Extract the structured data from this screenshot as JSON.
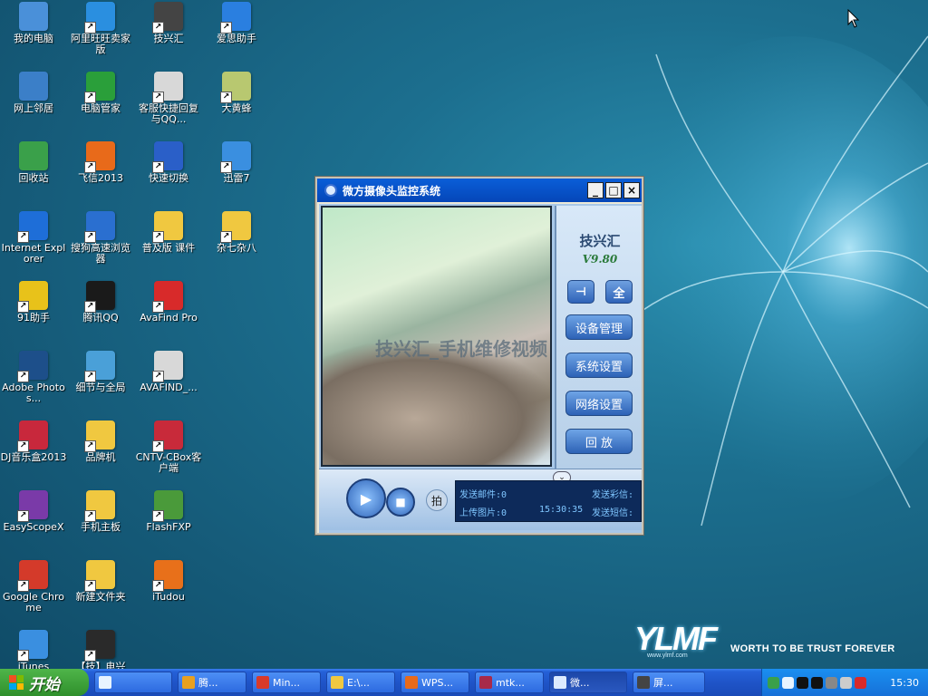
{
  "desktop": {
    "icons": [
      {
        "label": "我的电脑",
        "icon": "my-computer-icon",
        "color": "#4a90d9"
      },
      {
        "label": "网上邻居",
        "icon": "network-places-icon",
        "color": "#3b7fc8"
      },
      {
        "label": "回收站",
        "icon": "recycle-bin-icon",
        "color": "#3aa04a"
      },
      {
        "label": "Internet Explorer",
        "icon": "internet-explorer-icon",
        "color": "#1e6ed8"
      },
      {
        "label": "91助手",
        "icon": "assistant-91-icon",
        "color": "#e8c21a"
      },
      {
        "label": "Adobe Photos...",
        "icon": "photoshop-icon",
        "color": "#1d4f8a"
      },
      {
        "label": "DJ音乐盒2013",
        "icon": "dj-music-box-icon",
        "color": "#c8283c"
      },
      {
        "label": "EasyScopeX",
        "icon": "easyscopex-icon",
        "color": "#7a3aa8"
      },
      {
        "label": "Google Chrome",
        "icon": "chrome-icon",
        "color": "#d43a2a"
      },
      {
        "label": "iTunes",
        "icon": "itunes-icon",
        "color": "#3a8fe0"
      },
      {
        "label": "阿里旺旺卖家版",
        "icon": "aliwangwang-icon",
        "color": "#2a8fe0"
      },
      {
        "label": "电脑管家",
        "icon": "pc-manager-icon",
        "color": "#2a9f3a"
      },
      {
        "label": "飞信2013",
        "icon": "fetion-icon",
        "color": "#e86a1a"
      },
      {
        "label": "搜狗高速浏览器",
        "icon": "sogou-browser-icon",
        "color": "#2a6fd0"
      },
      {
        "label": "腾讯QQ",
        "icon": "qq-icon",
        "color": "#1a1a1a"
      },
      {
        "label": "细节与全局",
        "icon": "detail-global-icon",
        "color": "#4aa0d8"
      },
      {
        "label": "品牌机",
        "icon": "folder-icon",
        "color": "#f0c840"
      },
      {
        "label": "手机主板",
        "icon": "folder-icon",
        "color": "#f0c840"
      },
      {
        "label": "新建文件夹",
        "icon": "folder-icon",
        "color": "#f0c840"
      },
      {
        "label": "【技】电兴",
        "icon": "fct-icon",
        "color": "#2a2a2a"
      },
      {
        "label": "技兴汇",
        "icon": "jixinghui-icon",
        "color": "#444444"
      },
      {
        "label": "客服快捷回复与QQ...",
        "icon": "document-icon",
        "color": "#d8d8d8"
      },
      {
        "label": "快速切换",
        "icon": "quick-switch-icon",
        "color": "#2a5fc8"
      },
      {
        "label": "普及版 课件",
        "icon": "folder-icon",
        "color": "#f0c840"
      },
      {
        "label": "AvaFind Pro",
        "icon": "avafind-icon",
        "color": "#d82a2a"
      },
      {
        "label": "AVAFIND_...",
        "icon": "document-icon",
        "color": "#d8d8d8"
      },
      {
        "label": "CNTV-CBox客户端",
        "icon": "cntv-cbox-icon",
        "color": "#c82a3a"
      },
      {
        "label": "FlashFXP",
        "icon": "flashfxp-icon",
        "color": "#4a9a3a"
      },
      {
        "label": "iTudou",
        "icon": "itudou-icon",
        "color": "#e8701a"
      },
      {
        "label": "爱思助手",
        "icon": "aisi-assistant-icon",
        "color": "#2a7fe0"
      },
      {
        "label": "大黄蜂",
        "icon": "bumblebee-icon",
        "color": "#b8c870"
      },
      {
        "label": "迅雷7",
        "icon": "thunder-icon",
        "color": "#3a8fe0"
      },
      {
        "label": "杂七杂八",
        "icon": "folder-icon",
        "color": "#f0c840"
      }
    ]
  },
  "wallpaper": {
    "logo": "YLMF",
    "url": "www.ylmf.com",
    "tagline": "WORTH TO BE TRUST FOREVER"
  },
  "window": {
    "title": "微方摄像头监控系统",
    "minimize": "_",
    "maximize": "□",
    "close": "×",
    "video_overlay": "技兴汇_手机维修视频",
    "brand": "技兴汇",
    "version": "V9.80",
    "pin_button": "⊣",
    "full_button": "全",
    "buttons": [
      "设备管理",
      "系统设置",
      "网络设置",
      "回 放"
    ],
    "play_label": "▶",
    "stop_label": "■",
    "shoot_label": "拍",
    "collapse_label": "⌄",
    "status": {
      "send_mail": "发送邮件:0",
      "send_video": "发送彩信:",
      "upload_image": "上传图片:0",
      "time": "15:30:35",
      "send_sms": "发送短信:"
    }
  },
  "taskbar": {
    "start_label": "开始",
    "tasks": [
      {
        "label": "",
        "icon": "ie-task-icon",
        "color": "#e8f4ff"
      },
      {
        "label": "腾...",
        "icon": "chrome-task-icon",
        "color": "#e8a020"
      },
      {
        "label": "Min...",
        "icon": "gmail-task-icon",
        "color": "#d83a2a"
      },
      {
        "label": "E:\\...",
        "icon": "explorer-task-icon",
        "color": "#f0c840"
      },
      {
        "label": "WPS...",
        "icon": "wps-task-icon",
        "color": "#e86a1a"
      },
      {
        "label": "mtk...",
        "icon": "mtk-task-icon",
        "color": "#a82a4a"
      },
      {
        "label": "微...",
        "icon": "camera-task-icon",
        "color": "#dcebff"
      },
      {
        "label": "屏...",
        "icon": "screen-task-icon",
        "color": "#444444"
      }
    ],
    "clock": "15:30"
  },
  "colors": {
    "title_bar": "#0a5ed8",
    "taskbar": "#2561d8",
    "start_button": "#3fa03c",
    "tray": "#1a8ff0"
  }
}
